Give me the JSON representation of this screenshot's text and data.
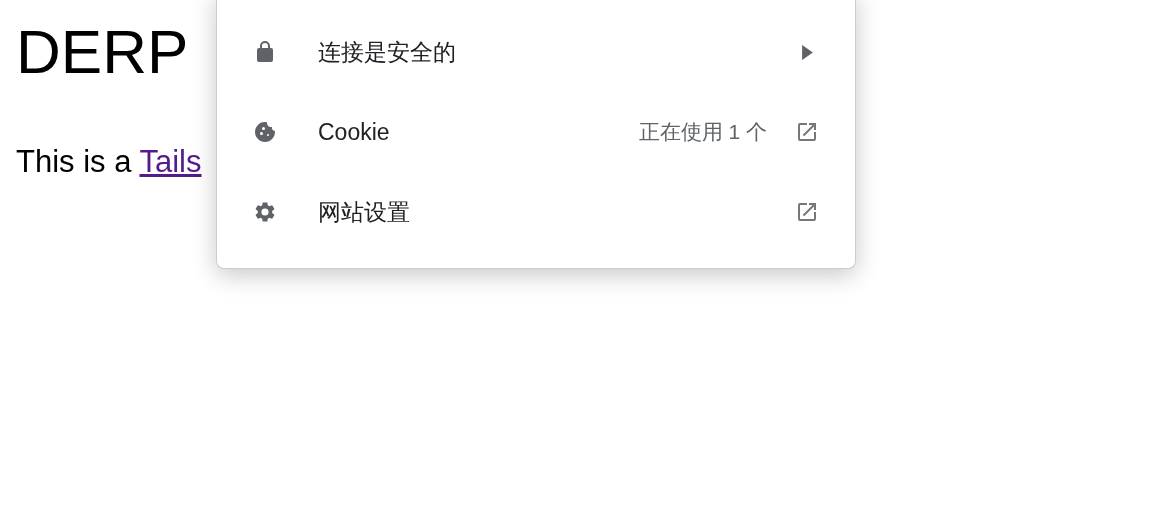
{
  "page": {
    "heading": "DERP",
    "paragraph_text": "This is a",
    "link": "Tails"
  },
  "popup": {
    "items": [
      {
        "kind": "submenu",
        "label": "连接是安全的"
      },
      {
        "kind": "external",
        "label": "Cookie",
        "detail": "正在使用 1 个"
      },
      {
        "kind": "external",
        "label": "网站设置"
      }
    ]
  }
}
